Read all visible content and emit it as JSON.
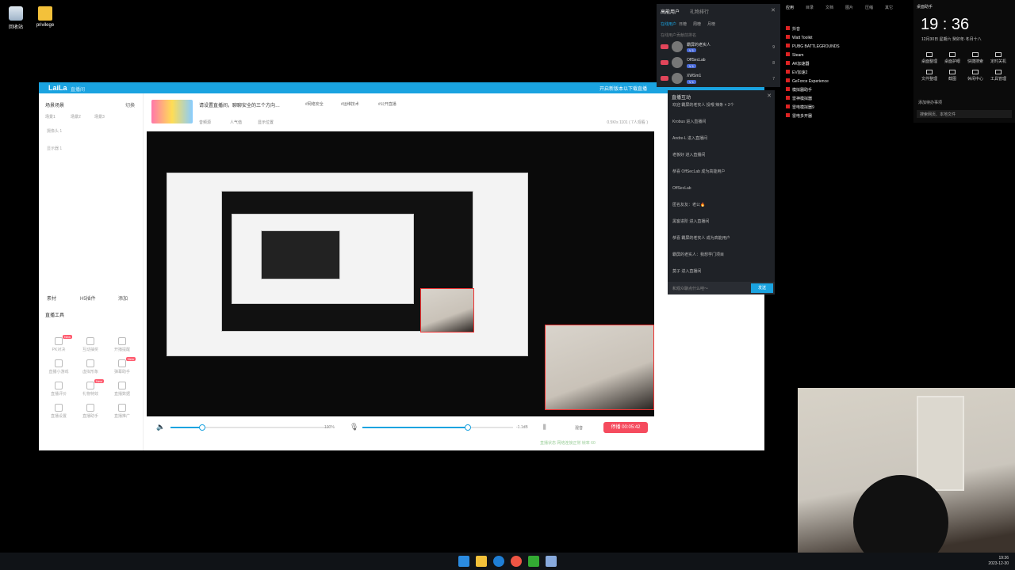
{
  "desktop": {
    "icons": [
      {
        "label": "回收站"
      },
      {
        "label": "privilege"
      }
    ]
  },
  "window": {
    "brand": "LaiLa",
    "sub": "直播间",
    "cta": "开启新版本以下载直播",
    "sidebar": {
      "header": "场景场景",
      "switch": "切换",
      "scenes": [
        "场景1",
        "场景2",
        "场景3"
      ],
      "sources": [
        "摄像头 1",
        "显示器 1"
      ],
      "bottom_tabs": [
        "素材",
        "H5插件",
        "添加"
      ],
      "tools_title": "直播工具",
      "tools": [
        {
          "label": "PK对决",
          "new": "New"
        },
        {
          "label": "互动抽奖",
          "new": ""
        },
        {
          "label": "开播提醒",
          "new": ""
        },
        {
          "label": "直播小游戏",
          "new": ""
        },
        {
          "label": "虚拟形象",
          "new": ""
        },
        {
          "label": "弹幕助手",
          "new": "New"
        },
        {
          "label": "直播评价",
          "new": ""
        },
        {
          "label": "礼物特效",
          "new": "New"
        },
        {
          "label": "直播数据",
          "new": ""
        },
        {
          "label": "直播设置",
          "new": ""
        },
        {
          "label": "直播助手",
          "new": ""
        },
        {
          "label": "直播推广",
          "new": ""
        }
      ]
    },
    "info": {
      "title": "请设置直播间，聊聊安全的三个方向…",
      "tags": [
        "#网络安全",
        "#运维技术",
        "#公开直播"
      ],
      "meta": [
        "音频源",
        "人气值",
        "显示位置"
      ],
      "bitrate": "0.5K/s 1101 ( 7人观看 )"
    },
    "controls": {
      "vol_pct": "100%",
      "db": "-1.1dB",
      "vol_level": 0.2,
      "mic_level": 0.7,
      "stop": "停播 00:05:42",
      "label_mix": "混音"
    },
    "status": "直播状态  网络连接正常  帧率 60"
  },
  "viewers": {
    "tabs": [
      "高能用户",
      "礼物排行"
    ],
    "subtabs": [
      "在线用户",
      "日榜",
      "周榜",
      "月榜"
    ],
    "hint": "在线用户贡献前排名",
    "list": [
      {
        "name": "霸屏的老实人",
        "count": "9"
      },
      {
        "name": "OffSecLab",
        "count": "8"
      },
      {
        "name": "XWSm1",
        "count": "7"
      }
    ]
  },
  "chat": {
    "title": "直播互动",
    "messages": [
      "欢迎 霸屏的老实人 投喂 辣条 × 2个",
      "Krobus 进入直播间",
      "Andre-L 进入直播间",
      "老板好 进入直播间",
      "恭喜 OffSecLab 成为高能用户",
      "OffSecLab",
      "匿名友友：老公🔥",
      "黑客进阶 进入直播间",
      "恭喜 霸屏的老实人 成为高能用户",
      "霸屏的老实人：我想学门项目",
      "莫子 进入直播间"
    ],
    "placeholder": "和观众聊点什么吧～",
    "send": "发送"
  },
  "applist": {
    "tabs": [
      "应用",
      "目录",
      "文档",
      "图片",
      "压缩",
      "其它"
    ],
    "apps": [
      "抖音",
      "Watt Toolkit",
      "PUBG BATTLEGROUNDS",
      "Steam",
      "AK加速器",
      "EV加速2",
      "GeForce Experience",
      "模拟器助手",
      "雷神模拟器",
      "雷电模拟器9",
      "雷电多开器"
    ]
  },
  "clock": {
    "title": "桌面助手",
    "time": "19 : 36",
    "date": "12月30日  星期六  癸卯年·冬月十八",
    "widgets": [
      "桌面整理",
      "桌面护眼",
      "快捷搜索",
      "定时关机",
      "文件整理",
      "截图",
      "休闲中心",
      "工具管理"
    ],
    "add": "添加待办事项",
    "search": "搜索网页、本地文件"
  },
  "taskbar": {
    "time": "19:36",
    "date": "2023-12-30"
  }
}
